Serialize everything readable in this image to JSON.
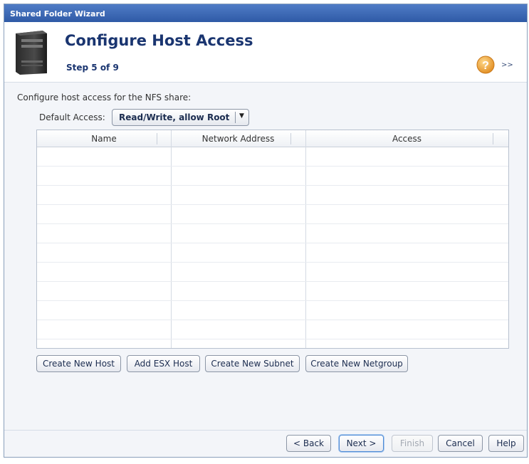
{
  "window": {
    "title": "Shared Folder Wizard"
  },
  "header": {
    "title": "Configure Host Access",
    "step": "Step 5 of 9",
    "expand_label": ">>"
  },
  "main": {
    "intro": "Configure host access for the NFS share:",
    "default_access": {
      "label": "Default Access:",
      "value": "Read/Write, allow Root"
    },
    "table": {
      "columns": [
        "Name",
        "Network Address",
        "Access"
      ],
      "rows": []
    },
    "actions": {
      "create_host": "Create New Host",
      "add_esx": "Add ESX Host",
      "create_subnet": "Create New Subnet",
      "create_netgroup": "Create New Netgroup"
    }
  },
  "footer": {
    "back": "< Back",
    "next": "Next >",
    "finish": "Finish",
    "cancel": "Cancel",
    "help": "Help"
  },
  "colors": {
    "titlebar": "#3a67b5",
    "heading": "#1a3570",
    "help_icon": "#f0a93a"
  }
}
